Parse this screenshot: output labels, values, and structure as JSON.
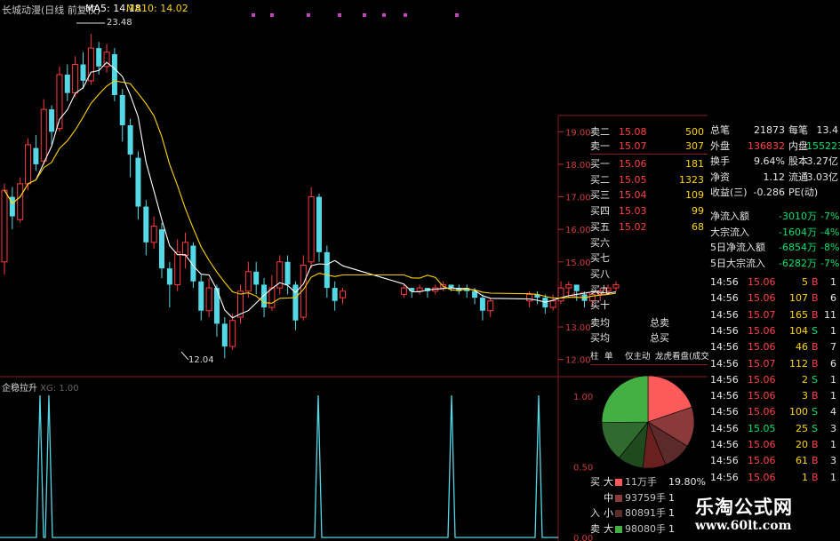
{
  "header": {
    "title": "长城动漫(日线 前复权)",
    "ma5_label": "MA5:",
    "ma5_value": "14.18",
    "ma10_label": "MA10:",
    "ma10_value": "14.02",
    "ma5_color": "#ffffff",
    "ma10_color": "#ffd400"
  },
  "subchart": {
    "name": "企稳拉升",
    "indicator": "XG: 1.00",
    "scale": [
      "1.00",
      "0.50",
      "0.00"
    ],
    "signals": [
      45,
      55,
      358,
      508,
      606
    ]
  },
  "chart_data": {
    "type": "candlestick",
    "y_axis_labels": [
      "19.00",
      "18.00",
      "17.00",
      "16.00",
      "15.00",
      "14.00",
      "13.00",
      "12.00"
    ],
    "ylim": [
      11.8,
      19.5
    ],
    "high_label": "23.48",
    "low_label": "12.04",
    "candles": [
      [
        15.0,
        17.2,
        14.6,
        17.4
      ],
      [
        17.0,
        16.4,
        16.0,
        17.3
      ],
      [
        16.3,
        17.4,
        16.2,
        17.6
      ],
      [
        17.4,
        18.6,
        17.2,
        18.8
      ],
      [
        18.5,
        18.0,
        17.8,
        18.9
      ],
      [
        18.1,
        19.8,
        18.0,
        20.3
      ],
      [
        19.8,
        19.0,
        18.6,
        20.0
      ],
      [
        19.1,
        21.5,
        19.0,
        21.9
      ],
      [
        21.5,
        20.6,
        20.2,
        22.0
      ],
      [
        20.6,
        22.0,
        20.4,
        22.4
      ],
      [
        22.0,
        21.2,
        20.8,
        22.6
      ],
      [
        21.2,
        22.8,
        21.0,
        23.48
      ],
      [
        22.8,
        21.9,
        21.5,
        23.1
      ],
      [
        21.9,
        22.6,
        21.6,
        23.0
      ],
      [
        22.5,
        20.5,
        20.2,
        22.8
      ],
      [
        20.5,
        19.2,
        18.7,
        20.8
      ],
      [
        19.2,
        18.3,
        17.6,
        19.4
      ],
      [
        18.2,
        16.7,
        16.3,
        18.4
      ],
      [
        16.7,
        15.6,
        15.2,
        16.9
      ],
      [
        15.6,
        16.1,
        15.4,
        16.4
      ],
      [
        16.0,
        14.8,
        14.5,
        16.2
      ],
      [
        14.8,
        14.3,
        13.6,
        15.0
      ],
      [
        14.3,
        15.3,
        14.1,
        15.7
      ],
      [
        15.2,
        15.6,
        14.8,
        15.9
      ],
      [
        15.5,
        14.4,
        14.2,
        15.6
      ],
      [
        14.4,
        13.5,
        13.2,
        14.6
      ],
      [
        13.5,
        14.2,
        13.3,
        14.5
      ],
      [
        14.2,
        13.1,
        12.7,
        14.3
      ],
      [
        13.1,
        12.4,
        12.04,
        13.3
      ],
      [
        12.4,
        13.2,
        12.3,
        13.4
      ],
      [
        13.3,
        14.1,
        13.1,
        14.3
      ],
      [
        14.1,
        14.7,
        13.9,
        15.0
      ],
      [
        14.7,
        14.3,
        14.0,
        15.0
      ],
      [
        14.3,
        13.6,
        13.3,
        14.5
      ],
      [
        13.6,
        14.2,
        13.5,
        14.6
      ],
      [
        14.2,
        15.0,
        14.0,
        15.2
      ],
      [
        15.0,
        14.3,
        14.0,
        15.2
      ],
      [
        14.3,
        13.2,
        12.9,
        14.4
      ],
      [
        13.3,
        14.9,
        13.2,
        15.2
      ],
      [
        15.0,
        17.0,
        14.8,
        17.3
      ],
      [
        17.0,
        15.3,
        15.0,
        17.1
      ],
      [
        15.3,
        14.2,
        13.9,
        15.5
      ],
      [
        14.2,
        13.8,
        13.5,
        14.4
      ],
      [
        13.9,
        14.1,
        13.7,
        14.2
      ],
      [
        14.0,
        14.2,
        13.9,
        14.3
      ],
      [
        14.2,
        14.1,
        13.9,
        14.2
      ],
      [
        14.1,
        14.2,
        14.0,
        14.3
      ],
      [
        14.2,
        14.1,
        13.9,
        14.2
      ],
      [
        14.1,
        14.2,
        14.0,
        14.3
      ],
      [
        14.2,
        14.3,
        14.1,
        14.4
      ],
      [
        14.3,
        14.2,
        14.1,
        14.3
      ],
      [
        14.2,
        14.1,
        14.0,
        14.3
      ],
      [
        14.2,
        14.1,
        13.9,
        14.3
      ],
      [
        14.1,
        13.9,
        13.7,
        14.2
      ],
      [
        13.9,
        13.5,
        13.2,
        14.0
      ],
      [
        13.5,
        13.8,
        13.3,
        13.9
      ],
      [
        13.8,
        14.0,
        13.6,
        14.1
      ],
      [
        14.0,
        13.9,
        13.7,
        14.1
      ],
      [
        13.9,
        13.6,
        13.4,
        14.0
      ],
      [
        13.6,
        13.8,
        13.5,
        14.0
      ],
      [
        13.8,
        14.2,
        13.7,
        14.4
      ],
      [
        14.2,
        14.3,
        14.0,
        14.4
      ],
      [
        14.3,
        14.1,
        13.8,
        14.3
      ],
      [
        14.0,
        13.8,
        13.6,
        14.1
      ],
      [
        13.8,
        14.0,
        13.6,
        14.1
      ],
      [
        14.0,
        14.1,
        13.8,
        14.2
      ],
      [
        14.1,
        14.2,
        14.0,
        14.3
      ],
      [
        14.2,
        14.3,
        14.1,
        14.4
      ]
    ]
  },
  "order_book": {
    "sell": [
      {
        "label": "卖二",
        "price": "15.08",
        "vol": "500"
      },
      {
        "label": "卖一",
        "price": "15.07",
        "vol": "307"
      }
    ],
    "buy": [
      {
        "label": "买一",
        "price": "15.06",
        "vol": "181"
      },
      {
        "label": "买二",
        "price": "15.05",
        "vol": "1323"
      },
      {
        "label": "买三",
        "price": "15.04",
        "vol": "109"
      },
      {
        "label": "买四",
        "price": "15.03",
        "vol": "99"
      },
      {
        "label": "买五",
        "price": "15.02",
        "vol": "68"
      },
      {
        "label": "买六",
        "price": "",
        "vol": ""
      },
      {
        "label": "买七",
        "price": "",
        "vol": ""
      },
      {
        "label": "买八",
        "price": "",
        "vol": ""
      },
      {
        "label": "买九",
        "price": "",
        "vol": ""
      },
      {
        "label": "买十",
        "price": "",
        "vol": ""
      }
    ],
    "sell_avg": "卖均",
    "buy_avg": "买均",
    "total_sell": "总卖",
    "total_buy": "总买"
  },
  "stats": [
    {
      "k1": "总笔",
      "v1": "21873",
      "k2": "每笔",
      "v2": "13.4",
      "c1": "wht",
      "c2": "wht"
    },
    {
      "k1": "外盘",
      "v1": "136832",
      "k2": "内盘",
      "v2": "155223",
      "c1": "red",
      "c2": "grn"
    },
    {
      "k1": "换手",
      "v1": "9.64%",
      "k2": "股本",
      "v2": "3.27亿",
      "c1": "wht",
      "c2": "wht"
    },
    {
      "k1": "净资",
      "v1": "1.12",
      "k2": "流通",
      "v2": "3.03亿",
      "c1": "wht",
      "c2": "wht"
    },
    {
      "k1": "收益(三)",
      "v1": "-0.286",
      "k2": "PE(动)",
      "v2": "",
      "c1": "wht",
      "c2": "wht"
    }
  ],
  "flows": [
    {
      "label": "净流入额",
      "value": "-3010万",
      "pct": "-7%"
    },
    {
      "label": "大宗流入",
      "value": "-1604万",
      "pct": "-4%"
    },
    {
      "label": "5日净流入额",
      "value": "-6854万",
      "pct": "-8%"
    },
    {
      "label": "5日大宗流入",
      "value": "-6282万",
      "pct": "-7%"
    }
  ],
  "ticks": [
    {
      "time": "14:56",
      "price": "15.06",
      "vol": "5",
      "side": "B",
      "extra": "1"
    },
    {
      "time": "14:56",
      "price": "15.06",
      "vol": "107",
      "side": "B",
      "extra": "6"
    },
    {
      "time": "14:56",
      "price": "15.07",
      "vol": "165",
      "side": "B",
      "extra": "11"
    },
    {
      "time": "14:56",
      "price": "15.06",
      "vol": "104",
      "side": "S",
      "extra": "1"
    },
    {
      "time": "14:56",
      "price": "15.06",
      "vol": "46",
      "side": "B",
      "extra": "7"
    },
    {
      "time": "14:56",
      "price": "15.07",
      "vol": "112",
      "side": "B",
      "extra": "6"
    },
    {
      "time": "14:56",
      "price": "15.06",
      "vol": "2",
      "side": "S",
      "extra": "1"
    },
    {
      "time": "14:56",
      "price": "15.06",
      "vol": "3",
      "side": "B",
      "extra": "1"
    },
    {
      "time": "14:56",
      "price": "15.06",
      "vol": "100",
      "side": "S",
      "extra": "4"
    },
    {
      "time": "14:56",
      "price": "15.05",
      "vol": "25",
      "side": "S",
      "extra": "3"
    },
    {
      "time": "14:56",
      "price": "15.06",
      "vol": "20",
      "side": "B",
      "extra": "1"
    },
    {
      "time": "14:56",
      "price": "15.06",
      "vol": "61",
      "side": "B",
      "extra": "3"
    },
    {
      "time": "14:56",
      "price": "15.06",
      "vol": "1",
      "side": "B",
      "extra": "1"
    }
  ],
  "tabs": [
    "柱",
    "单",
    "仅主动",
    "龙虎看盘(成交量/笔"
  ],
  "pie": {
    "slices": [
      {
        "value": 19.8,
        "color": "#ff5a5a"
      },
      {
        "value": 14,
        "color": "#8a3a3a"
      },
      {
        "value": 10,
        "color": "#5c2a2a"
      },
      {
        "value": 8,
        "color": "#6b2020"
      },
      {
        "value": 9,
        "color": "#1e4a1e"
      },
      {
        "value": 14,
        "color": "#2f6b2f"
      },
      {
        "value": 25.2,
        "color": "#44b044"
      }
    ]
  },
  "legend": [
    {
      "side": "买",
      "size": "大",
      "value": "11万手",
      "pct": "19.80%",
      "color": "#ff5a5a"
    },
    {
      "side": "",
      "size": "中",
      "value": "93759手",
      "pct": "1",
      "color": "#8a3a3a"
    },
    {
      "side": "入",
      "size": "小",
      "value": "80891手",
      "pct": "1",
      "color": "#5c2a2a"
    },
    {
      "side": "卖",
      "size": "大",
      "value": "98080手",
      "pct": "1",
      "color": "#44b044"
    }
  ],
  "watermark": {
    "name": "乐淘公式网",
    "url": "www.60lt.com"
  }
}
